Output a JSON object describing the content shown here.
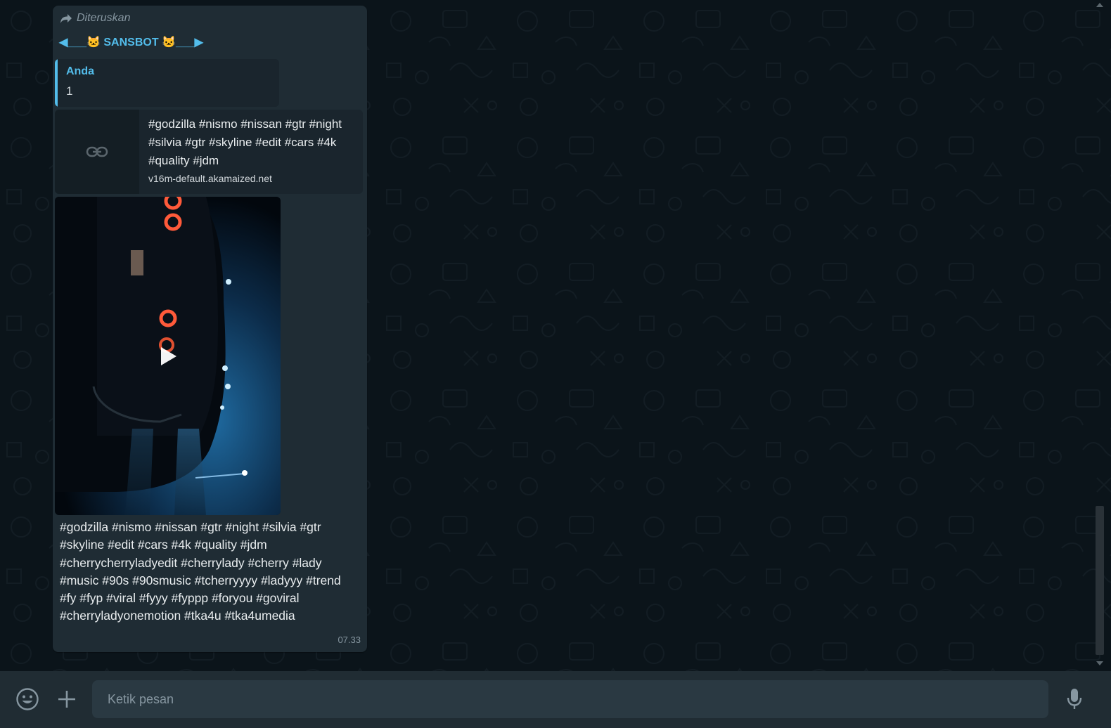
{
  "message": {
    "forwarded_label": "Diteruskan",
    "sender_name": "◀___🐱 SANSBOT 🐱___▶",
    "quote": {
      "author": "Anda",
      "text": "1"
    },
    "link_preview": {
      "title": "#godzilla #nismo #nissan #gtr #night #silvia #gtr #skyline #edit #cars #4k #quality #jdm",
      "domain": "v16m-default.akamaized.net",
      "icon": "link-icon"
    },
    "video": {
      "icon": "play-icon"
    },
    "caption": "#godzilla #nismo #nissan #gtr #night #silvia #gtr #skyline #edit #cars #4k #quality #jdm #cherrycherryladyedit #cherrylady #cherry #lady #music #90s #90smusic #tcherryyyy #ladyyy #trend #fy #fyp #viral #fyyy #fyppp #foryou #goviral #cherryladyonemotion #tka4u #tka4umedia",
    "time": "07.33"
  },
  "composer": {
    "placeholder": "Ketik pesan",
    "emoji_icon": "smiley-icon",
    "attach_icon": "plus-icon",
    "mic_icon": "microphone-icon"
  },
  "colors": {
    "chat_bg": "#0b141a",
    "bubble_bg": "#1f2c34",
    "accent": "#53bdeb",
    "footer_bg": "#202c33",
    "input_bg": "#2a3942"
  }
}
